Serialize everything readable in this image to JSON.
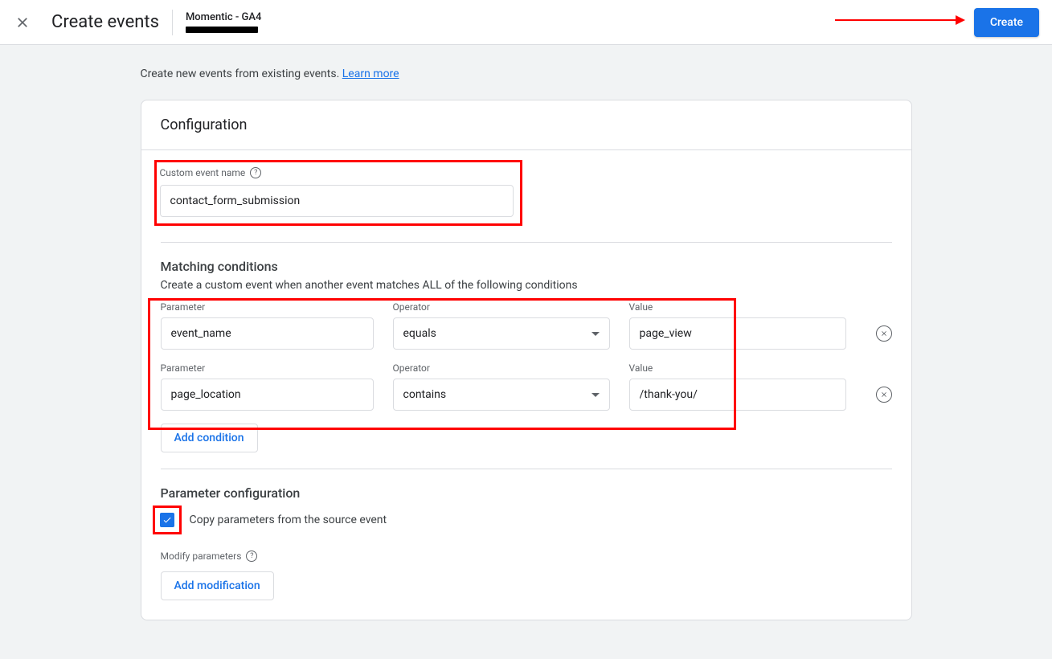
{
  "header": {
    "title": "Create events",
    "streamName": "Momentic - GA4",
    "createLabel": "Create"
  },
  "intro": {
    "text": "Create new events from existing events. ",
    "linkLabel": "Learn more"
  },
  "card": {
    "title": "Configuration",
    "customEventName": {
      "label": "Custom event name",
      "value": "contact_form_submission"
    },
    "matching": {
      "title": "Matching conditions",
      "subtitle": "Create a custom event when another event matches ALL of the following conditions",
      "labels": {
        "parameter": "Parameter",
        "operator": "Operator",
        "value": "Value"
      },
      "rows": [
        {
          "parameter": "event_name",
          "operator": "equals",
          "value": "page_view"
        },
        {
          "parameter": "page_location",
          "operator": "contains",
          "value": "/thank-you/"
        }
      ],
      "addConditionLabel": "Add condition"
    },
    "paramConfig": {
      "title": "Parameter configuration",
      "copyCheckbox": {
        "checked": true,
        "label": "Copy parameters from the source event"
      },
      "modifyLabel": "Modify parameters",
      "addModificationLabel": "Add modification"
    }
  }
}
